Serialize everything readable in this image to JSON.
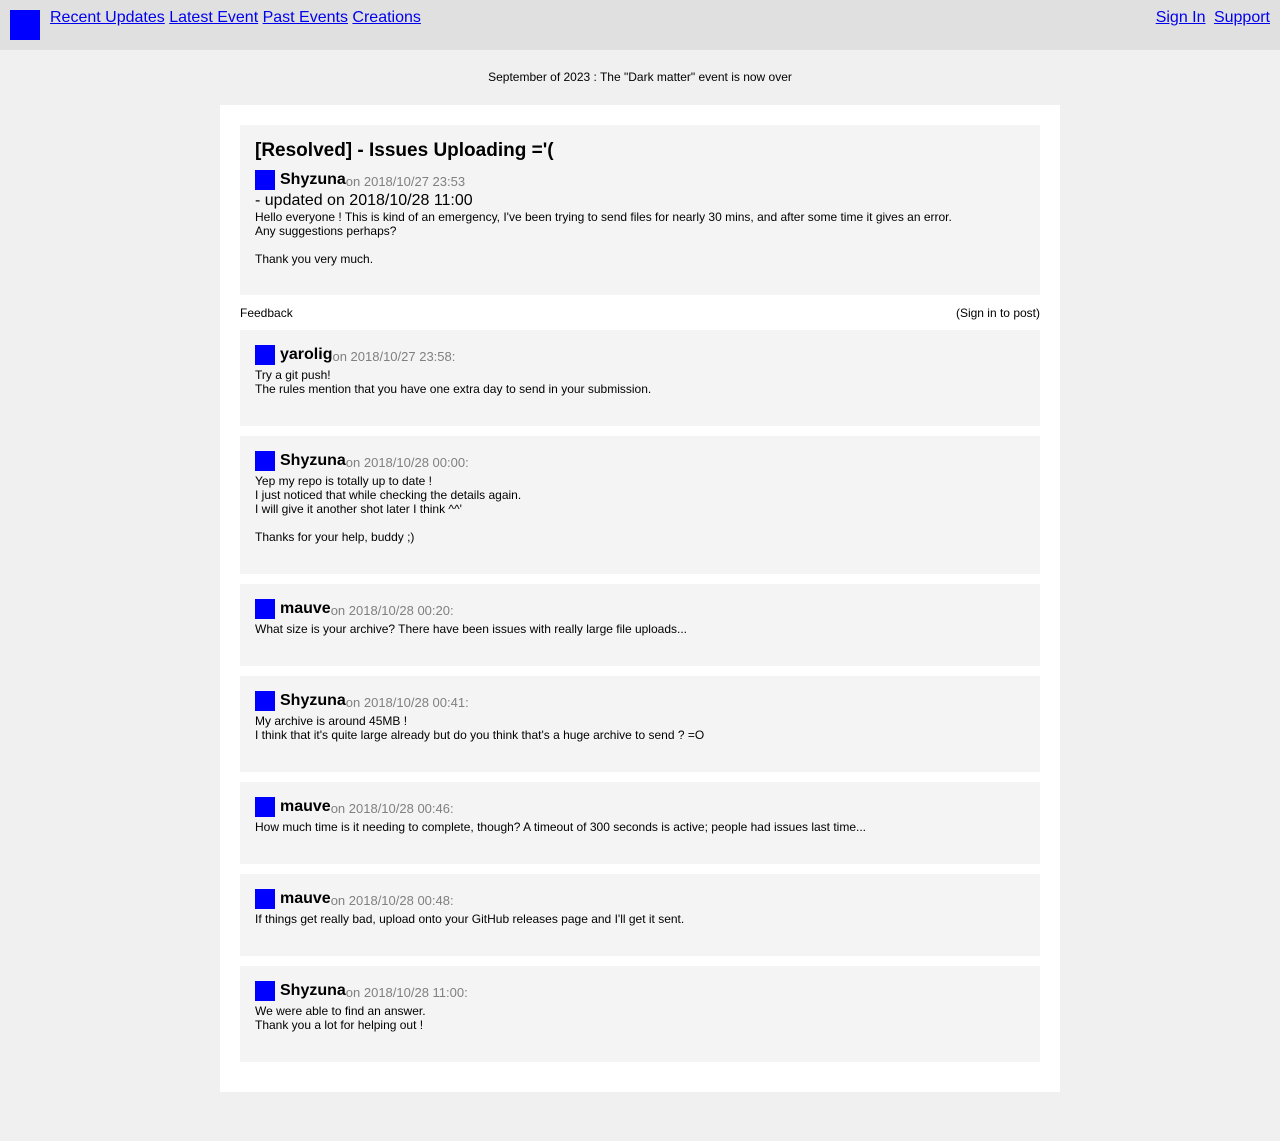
{
  "nav": {
    "logo_icon": "site-logo",
    "left_links": [
      "Recent Updates",
      "Latest Event",
      "Past Events",
      "Creations"
    ],
    "right_links": [
      "Sign In",
      "Support"
    ]
  },
  "banner": "September of 2023 : The \"Dark matter\" event is now over",
  "post": {
    "title": "[Resolved] - Issues Uploading ='(",
    "author": "Shyzuna",
    "date": "on 2018/10/27 23:53",
    "updated": "- updated on 2018/10/28 11:00",
    "paragraphs": [
      "Hello everyone ! This is kind of an emergency, I've been trying to send files for nearly 30 mins, and after some time it gives an error.\nAny suggestions perhaps?",
      "Thank you very much."
    ]
  },
  "feedback": {
    "label": "Feedback",
    "sign_in_note": "(Sign in to post)"
  },
  "comments": [
    {
      "author": "yarolig",
      "date": "on 2018/10/27 23:58:",
      "paragraphs": [
        "Try a git push!\nThe rules mention that you have one extra day to send in your submission."
      ]
    },
    {
      "author": "Shyzuna",
      "date": "on 2018/10/28 00:00:",
      "paragraphs": [
        "Yep my repo is totally up to date !\nI just noticed that while checking the details again.\nI will give it another shot later I think ^^'",
        "Thanks for your help, buddy ;)"
      ]
    },
    {
      "author": "mauve",
      "date": "on 2018/10/28 00:20:",
      "paragraphs": [
        "What size is your archive? There have been issues with really large file uploads..."
      ]
    },
    {
      "author": "Shyzuna",
      "date": "on 2018/10/28 00:41:",
      "paragraphs": [
        "My archive is around 45MB !\nI think that it's quite large already but do you think that's a huge archive to send ? =O"
      ]
    },
    {
      "author": "mauve",
      "date": "on 2018/10/28 00:46:",
      "paragraphs": [
        "How much time is it needing to complete, though? A timeout of 300 seconds is active; people had issues last time..."
      ]
    },
    {
      "author": "mauve",
      "date": "on 2018/10/28 00:48:",
      "paragraphs": [
        "If things get really bad, upload onto your GitHub releases page and I'll get it sent."
      ]
    },
    {
      "author": "Shyzuna",
      "date": "on 2018/10/28 11:00:",
      "paragraphs": [
        "We were able to find an answer.\nThank you a lot for helping out !"
      ]
    }
  ],
  "colors": {
    "avatar": "#0000ff",
    "link": "#0000ee",
    "topbar": "#e0e0e0",
    "page_bg": "#f0f0f0",
    "card_bg": "#f4f4f4"
  }
}
